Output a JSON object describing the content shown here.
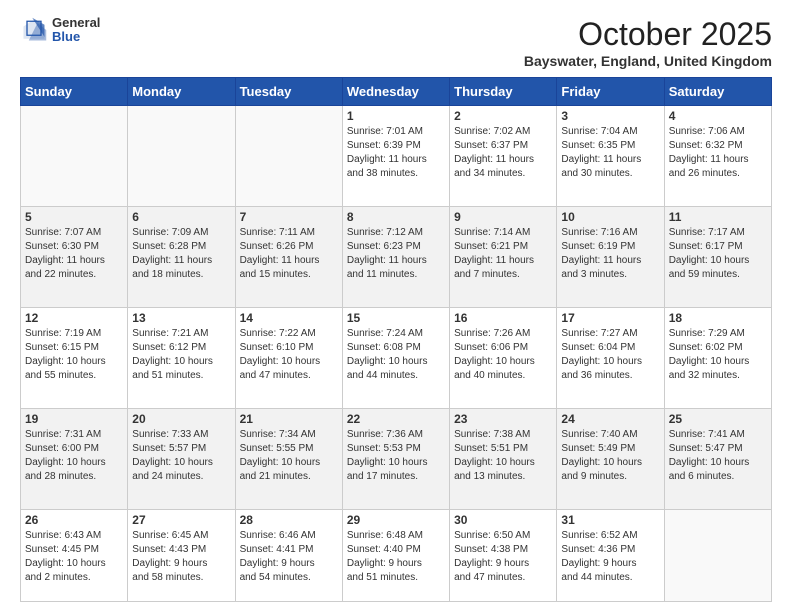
{
  "header": {
    "logo_general": "General",
    "logo_blue": "Blue",
    "month_title": "October 2025",
    "location": "Bayswater, England, United Kingdom"
  },
  "days_of_week": [
    "Sunday",
    "Monday",
    "Tuesday",
    "Wednesday",
    "Thursday",
    "Friday",
    "Saturday"
  ],
  "weeks": [
    [
      {
        "day": "",
        "info": ""
      },
      {
        "day": "",
        "info": ""
      },
      {
        "day": "",
        "info": ""
      },
      {
        "day": "1",
        "info": "Sunrise: 7:01 AM\nSunset: 6:39 PM\nDaylight: 11 hours\nand 38 minutes."
      },
      {
        "day": "2",
        "info": "Sunrise: 7:02 AM\nSunset: 6:37 PM\nDaylight: 11 hours\nand 34 minutes."
      },
      {
        "day": "3",
        "info": "Sunrise: 7:04 AM\nSunset: 6:35 PM\nDaylight: 11 hours\nand 30 minutes."
      },
      {
        "day": "4",
        "info": "Sunrise: 7:06 AM\nSunset: 6:32 PM\nDaylight: 11 hours\nand 26 minutes."
      }
    ],
    [
      {
        "day": "5",
        "info": "Sunrise: 7:07 AM\nSunset: 6:30 PM\nDaylight: 11 hours\nand 22 minutes."
      },
      {
        "day": "6",
        "info": "Sunrise: 7:09 AM\nSunset: 6:28 PM\nDaylight: 11 hours\nand 18 minutes."
      },
      {
        "day": "7",
        "info": "Sunrise: 7:11 AM\nSunset: 6:26 PM\nDaylight: 11 hours\nand 15 minutes."
      },
      {
        "day": "8",
        "info": "Sunrise: 7:12 AM\nSunset: 6:23 PM\nDaylight: 11 hours\nand 11 minutes."
      },
      {
        "day": "9",
        "info": "Sunrise: 7:14 AM\nSunset: 6:21 PM\nDaylight: 11 hours\nand 7 minutes."
      },
      {
        "day": "10",
        "info": "Sunrise: 7:16 AM\nSunset: 6:19 PM\nDaylight: 11 hours\nand 3 minutes."
      },
      {
        "day": "11",
        "info": "Sunrise: 7:17 AM\nSunset: 6:17 PM\nDaylight: 10 hours\nand 59 minutes."
      }
    ],
    [
      {
        "day": "12",
        "info": "Sunrise: 7:19 AM\nSunset: 6:15 PM\nDaylight: 10 hours\nand 55 minutes."
      },
      {
        "day": "13",
        "info": "Sunrise: 7:21 AM\nSunset: 6:12 PM\nDaylight: 10 hours\nand 51 minutes."
      },
      {
        "day": "14",
        "info": "Sunrise: 7:22 AM\nSunset: 6:10 PM\nDaylight: 10 hours\nand 47 minutes."
      },
      {
        "day": "15",
        "info": "Sunrise: 7:24 AM\nSunset: 6:08 PM\nDaylight: 10 hours\nand 44 minutes."
      },
      {
        "day": "16",
        "info": "Sunrise: 7:26 AM\nSunset: 6:06 PM\nDaylight: 10 hours\nand 40 minutes."
      },
      {
        "day": "17",
        "info": "Sunrise: 7:27 AM\nSunset: 6:04 PM\nDaylight: 10 hours\nand 36 minutes."
      },
      {
        "day": "18",
        "info": "Sunrise: 7:29 AM\nSunset: 6:02 PM\nDaylight: 10 hours\nand 32 minutes."
      }
    ],
    [
      {
        "day": "19",
        "info": "Sunrise: 7:31 AM\nSunset: 6:00 PM\nDaylight: 10 hours\nand 28 minutes."
      },
      {
        "day": "20",
        "info": "Sunrise: 7:33 AM\nSunset: 5:57 PM\nDaylight: 10 hours\nand 24 minutes."
      },
      {
        "day": "21",
        "info": "Sunrise: 7:34 AM\nSunset: 5:55 PM\nDaylight: 10 hours\nand 21 minutes."
      },
      {
        "day": "22",
        "info": "Sunrise: 7:36 AM\nSunset: 5:53 PM\nDaylight: 10 hours\nand 17 minutes."
      },
      {
        "day": "23",
        "info": "Sunrise: 7:38 AM\nSunset: 5:51 PM\nDaylight: 10 hours\nand 13 minutes."
      },
      {
        "day": "24",
        "info": "Sunrise: 7:40 AM\nSunset: 5:49 PM\nDaylight: 10 hours\nand 9 minutes."
      },
      {
        "day": "25",
        "info": "Sunrise: 7:41 AM\nSunset: 5:47 PM\nDaylight: 10 hours\nand 6 minutes."
      }
    ],
    [
      {
        "day": "26",
        "info": "Sunrise: 6:43 AM\nSunset: 4:45 PM\nDaylight: 10 hours\nand 2 minutes."
      },
      {
        "day": "27",
        "info": "Sunrise: 6:45 AM\nSunset: 4:43 PM\nDaylight: 9 hours\nand 58 minutes."
      },
      {
        "day": "28",
        "info": "Sunrise: 6:46 AM\nSunset: 4:41 PM\nDaylight: 9 hours\nand 54 minutes."
      },
      {
        "day": "29",
        "info": "Sunrise: 6:48 AM\nSunset: 4:40 PM\nDaylight: 9 hours\nand 51 minutes."
      },
      {
        "day": "30",
        "info": "Sunrise: 6:50 AM\nSunset: 4:38 PM\nDaylight: 9 hours\nand 47 minutes."
      },
      {
        "day": "31",
        "info": "Sunrise: 6:52 AM\nSunset: 4:36 PM\nDaylight: 9 hours\nand 44 minutes."
      },
      {
        "day": "",
        "info": ""
      }
    ]
  ]
}
